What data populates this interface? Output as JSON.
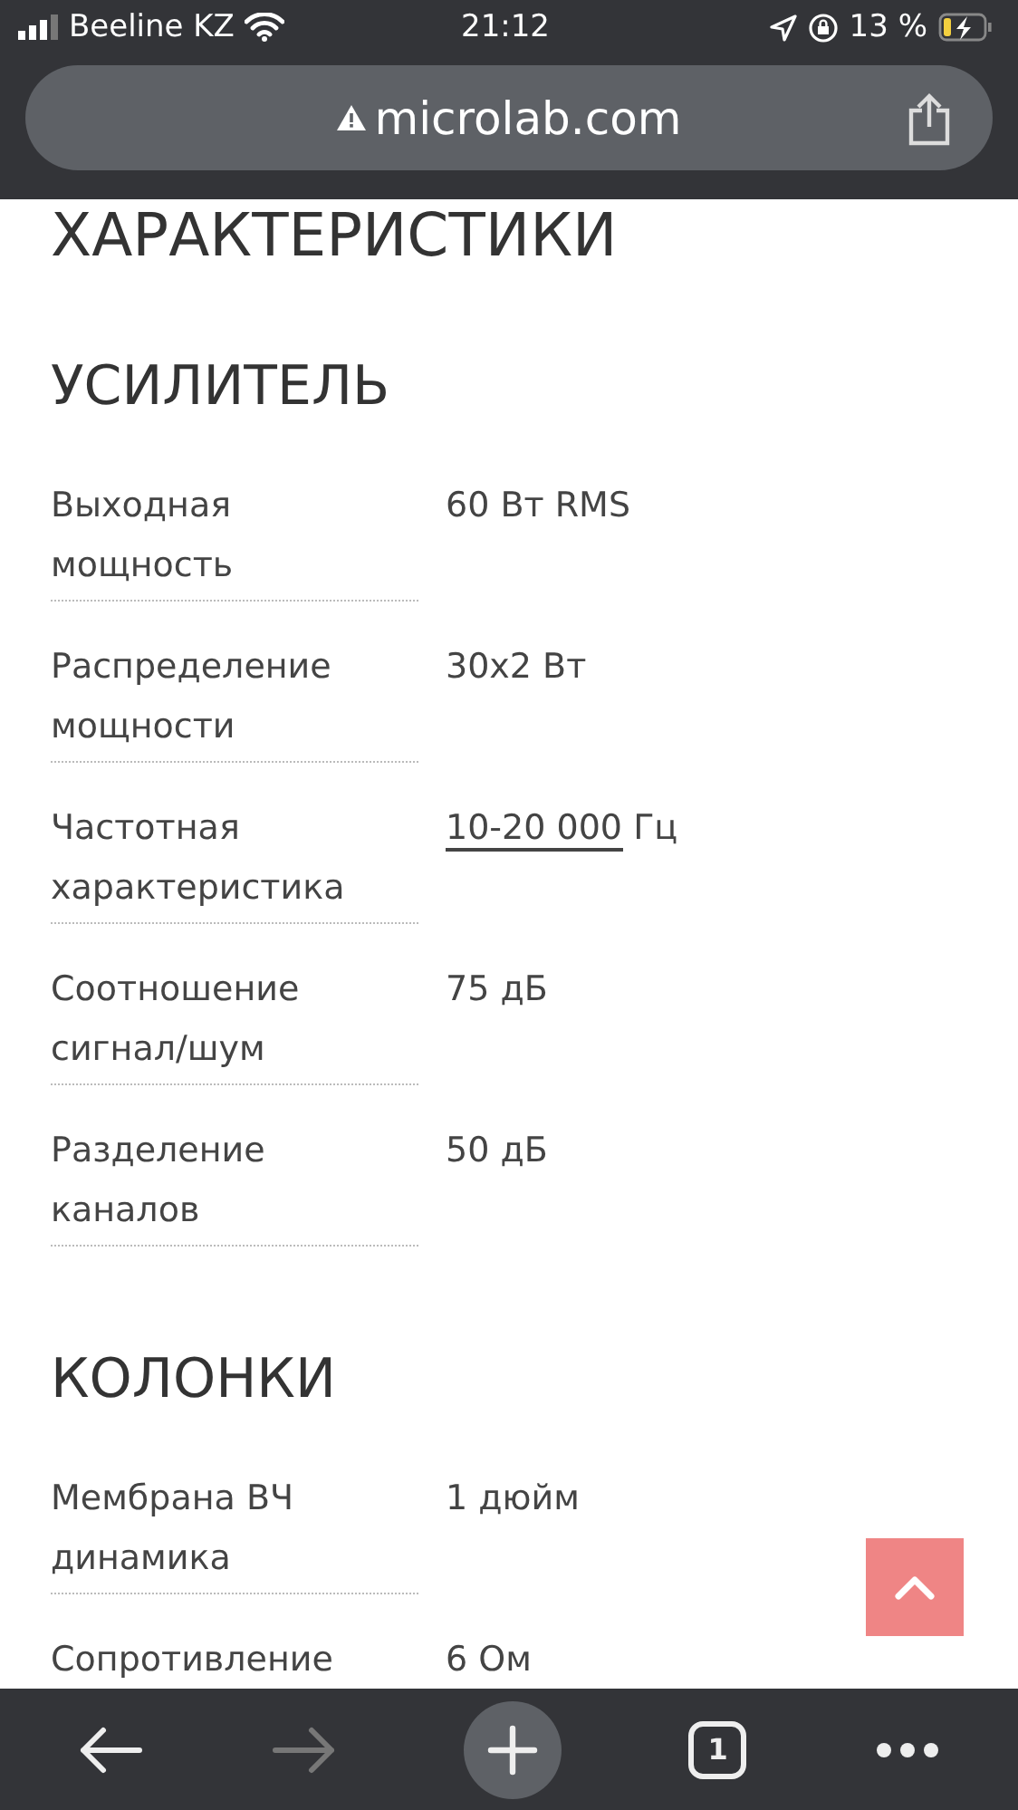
{
  "status_bar": {
    "carrier": "Beeline KZ",
    "time": "21:12",
    "battery": "13 %",
    "charging": true
  },
  "address_bar": {
    "url": "microlab.com",
    "insecure": true
  },
  "page": {
    "cut_heading": "ХАРАКТЕРИСТИКИ",
    "sections": [
      {
        "title": "УСИЛИТЕЛЬ",
        "specs": [
          {
            "label": "Выходная мощность",
            "value": "60 Вт RMS"
          },
          {
            "label": "Распределение мощности",
            "value": "30x2 Вт"
          },
          {
            "label": "Частотная характеристика",
            "link": "10-20 000",
            "value": "Гц"
          },
          {
            "label": "Соотношение сигнал/шум",
            "value": "75 дБ"
          },
          {
            "label": "Разделение каналов",
            "value": "50 дБ"
          }
        ]
      },
      {
        "title": "КОЛОНКИ",
        "specs": [
          {
            "label": "Мембрана ВЧ динамика",
            "value": "1 дюйм"
          },
          {
            "label": "Сопротивление",
            "value": "6 Ом"
          }
        ]
      }
    ]
  },
  "toolbar": {
    "back_disabled": false,
    "forward_disabled": true,
    "tab_count": "1"
  }
}
